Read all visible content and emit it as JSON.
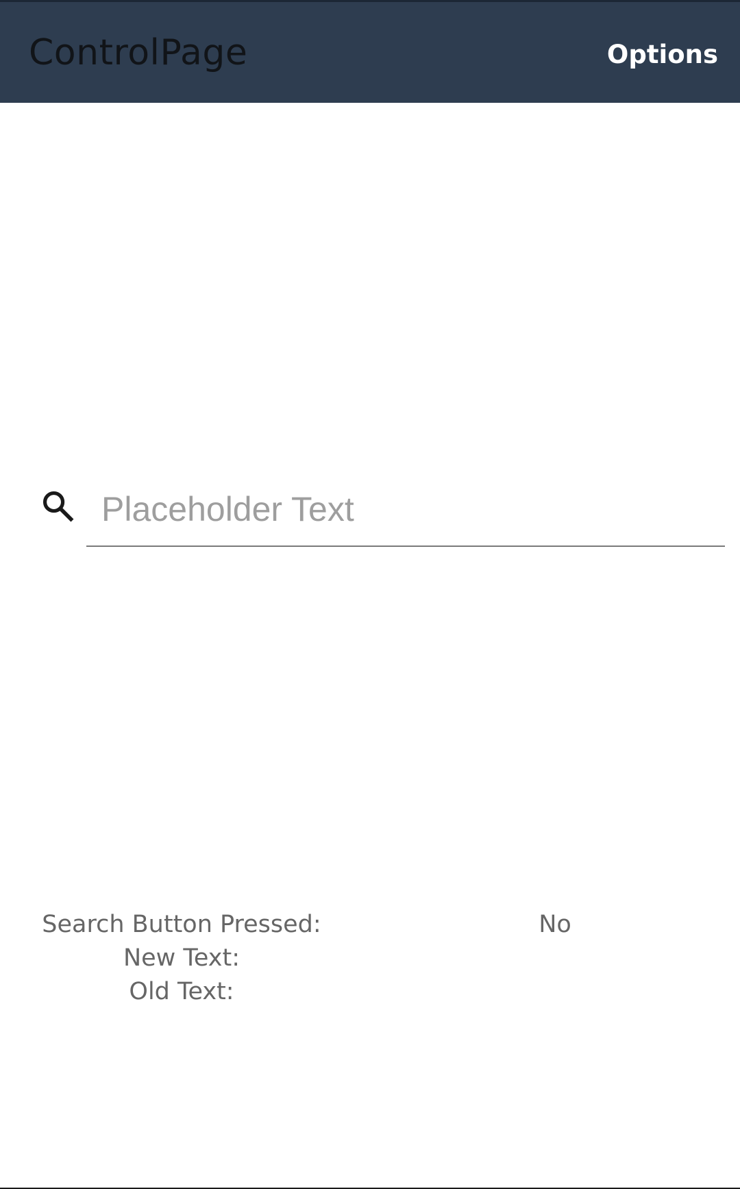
{
  "app_bar": {
    "title": "ControlPage",
    "options_label": "Options"
  },
  "search": {
    "placeholder": "Placeholder Text",
    "value": "",
    "icon": "search-icon"
  },
  "status": {
    "search_button_pressed_label": "Search Button Pressed:",
    "search_button_pressed_value": "No",
    "new_text_label": "New Text:",
    "new_text_value": "",
    "old_text_label": "Old Text:",
    "old_text_value": ""
  },
  "colors": {
    "app_bar_background": "#2e3d50",
    "placeholder": "#9e9e9e",
    "status_text": "#666666"
  }
}
